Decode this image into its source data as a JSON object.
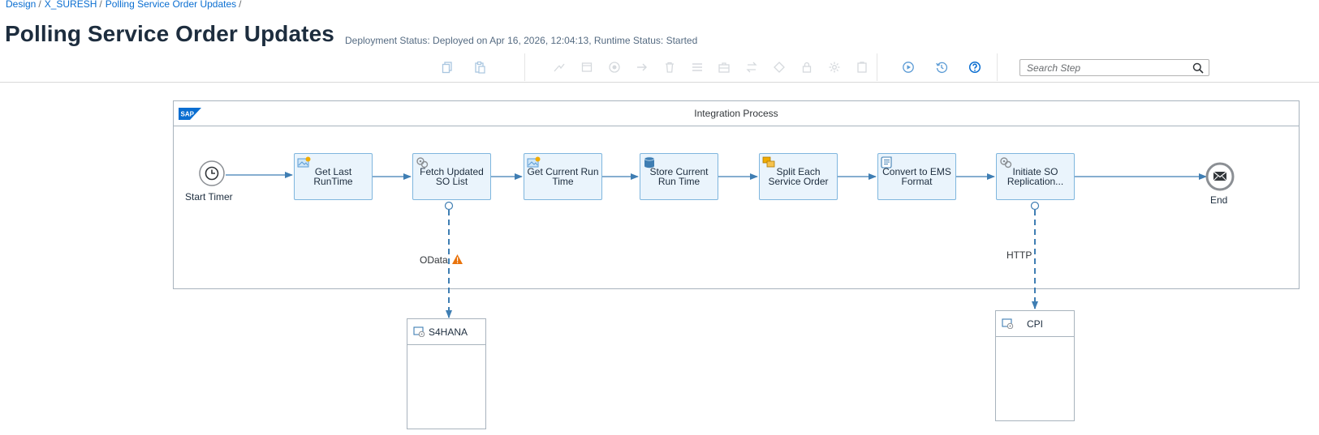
{
  "breadcrumb": {
    "items": [
      "Design",
      "X_SURESH",
      "Polling Service Order Updates"
    ],
    "separator": "/"
  },
  "page": {
    "title": "Polling Service Order Updates",
    "deployment_status": "Deployment Status: Deployed on Apr 16, 2026, 12:04:13, Runtime Status: Started"
  },
  "toolbar": {
    "search_placeholder": "Search Step",
    "icons": [
      "copy-icon",
      "paste-icon",
      "connect-icon",
      "container-icon",
      "target-icon",
      "arrow-right-icon",
      "delete-icon",
      "list-icon",
      "briefcase-icon",
      "swap-icon",
      "diamond-icon",
      "lock-icon",
      "settings-icon",
      "clipboard-icon",
      "play-circle-icon",
      "history-icon",
      "help-icon"
    ]
  },
  "process": {
    "pool_title": "Integration Process",
    "logo_text": "SAP",
    "start_event_label": "Start Timer",
    "end_event_label": "End",
    "steps": [
      {
        "label": "Get Last RunTime",
        "icon": "content-modifier-icon"
      },
      {
        "label": "Fetch Updated SO List",
        "icon": "request-reply-icon"
      },
      {
        "label": "Get Current Run Time",
        "icon": "content-modifier-icon"
      },
      {
        "label": "Store Current Run Time",
        "icon": "data-store-icon"
      },
      {
        "label": "Split Each Service Order",
        "icon": "splitter-icon"
      },
      {
        "label": "Convert to EMS Format",
        "icon": "script-icon"
      },
      {
        "label": "Initiate SO Replication...",
        "icon": "request-reply-icon"
      }
    ],
    "connections": [
      {
        "label": "OData",
        "warning": true
      },
      {
        "label": "HTTP",
        "warning": false
      }
    ],
    "participants": [
      {
        "name": "S4HANA"
      },
      {
        "name": "CPI"
      }
    ]
  },
  "colors": {
    "link": "#0a6ed1",
    "flow_line": "#3f7eb3",
    "step_fill": "#eaf4fc",
    "step_border": "#7fb6de",
    "warning": "#e9730c"
  }
}
